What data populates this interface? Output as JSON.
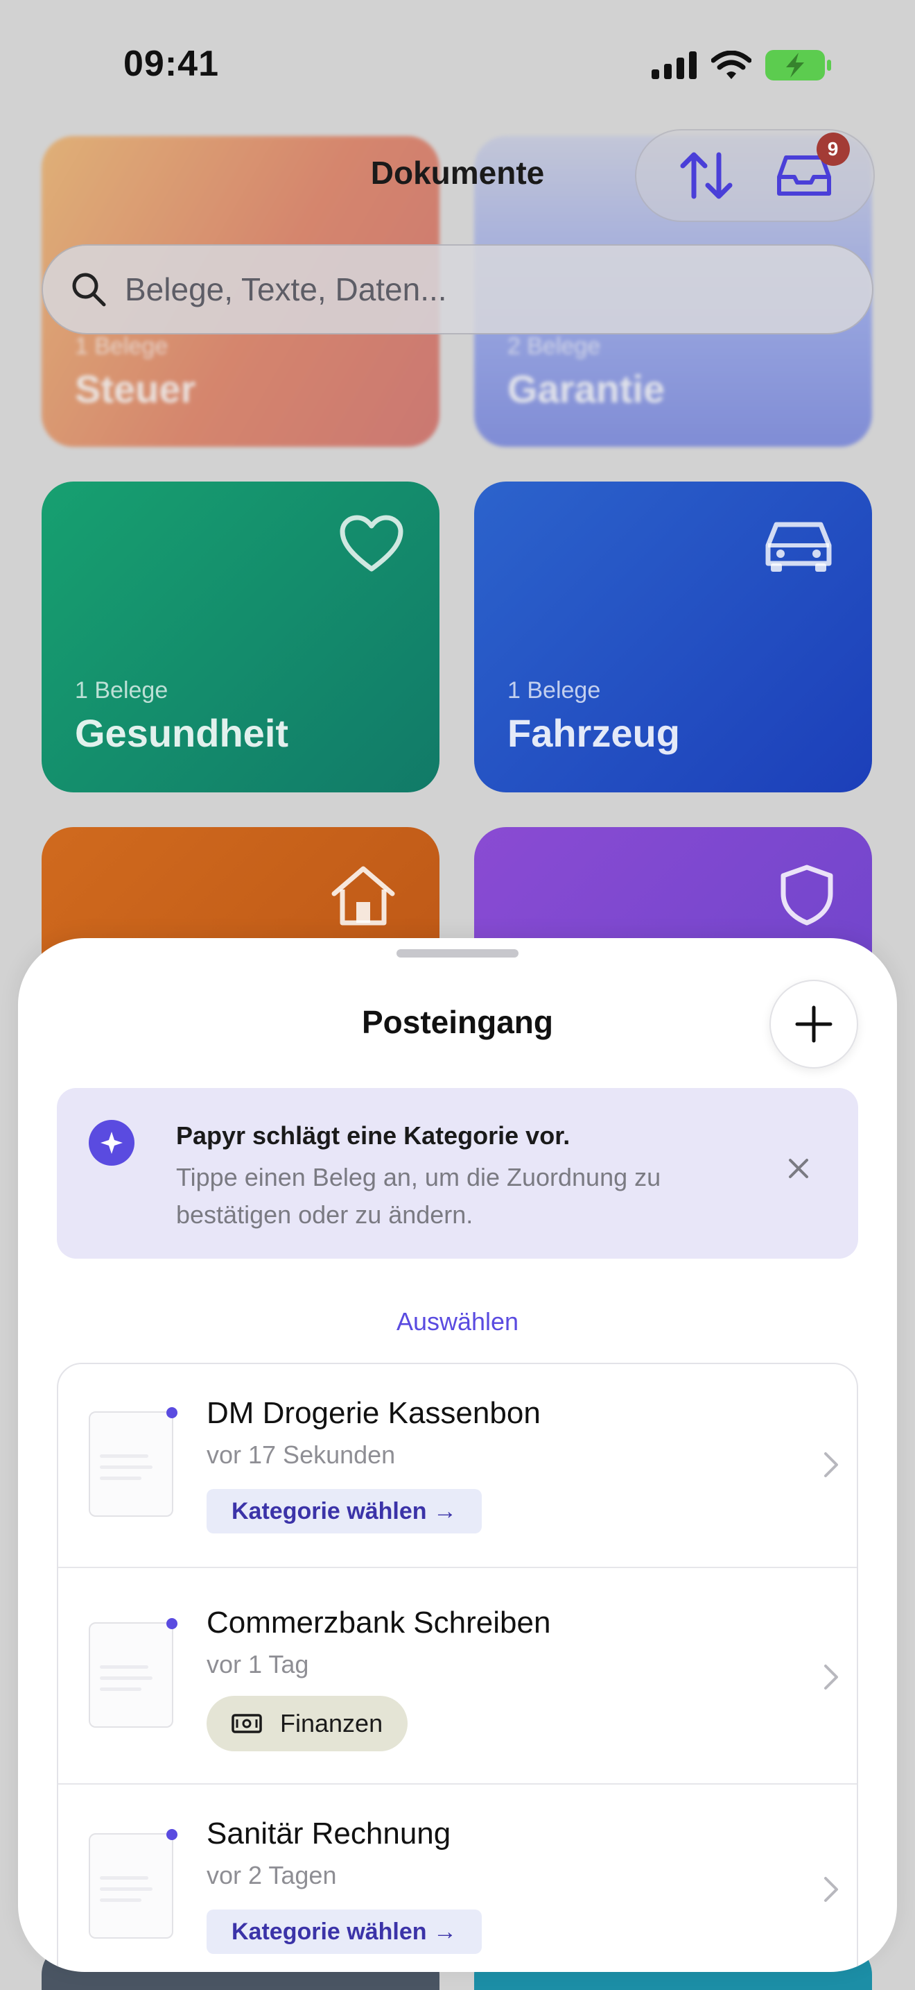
{
  "status_bar": {
    "time": "09:41"
  },
  "header": {
    "title": "Dokumente",
    "inbox_badge": "9"
  },
  "search": {
    "placeholder": "Belege, Texte, Daten..."
  },
  "categories": [
    {
      "count": "1 Belege",
      "name": "Steuer"
    },
    {
      "count": "2 Belege",
      "name": "Garantie"
    },
    {
      "count": "1 Belege",
      "name": "Gesundheit"
    },
    {
      "count": "1 Belege",
      "name": "Fahrzeug"
    }
  ],
  "inbox": {
    "title": "Posteingang",
    "hint": {
      "title": "Papyr schlägt eine Kategorie vor.",
      "text": "Tippe einen Beleg an, um die Zuordnung zu bestätigen oder zu ändern."
    },
    "select_label": "Auswählen",
    "items": [
      {
        "title": "DM Drogerie Kassenbon",
        "time": "vor 17 Sekunden",
        "action": "Kategorie wählen →"
      },
      {
        "title": "Commerzbank Schreiben",
        "time": "vor 1 Tag",
        "category": "Finanzen"
      },
      {
        "title": "Sanitär Rechnung",
        "time": "vor 2 Tagen",
        "action": "Kategorie wählen →"
      }
    ]
  },
  "colors": {
    "accent": "#5a4be0",
    "steuer": "#d9562b",
    "garantie": "#4a5fd8",
    "gesundheit": "#12876a",
    "fahrzeug": "#2148c4",
    "zuhause": "#c9621a",
    "versicherung": "#8048cf"
  }
}
